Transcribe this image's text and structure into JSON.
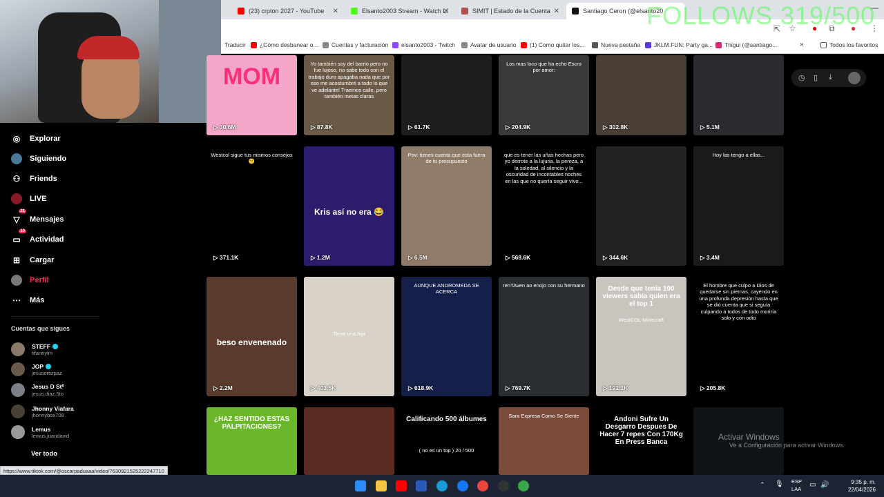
{
  "browser": {
    "tabs": [
      {
        "title": "(23) crpton 2027 - YouTube",
        "color": "#ff0000"
      },
      {
        "title": "Elsanto2003 Stream - Watch Li",
        "color": "#53fc18"
      },
      {
        "title": "SIMIT | Estado de la Cuenta",
        "color": "#b05050"
      },
      {
        "title": "Santiago Ceron (@elsanto20",
        "color": "#111111"
      }
    ],
    "bookmarks": [
      {
        "label": "Traducir"
      },
      {
        "label": "¿Cómo desbanear o..."
      },
      {
        "label": "Cuentas y facturación"
      },
      {
        "label": "elsanto2003 - Twitch"
      },
      {
        "label": "Avatar de usuario"
      },
      {
        "label": "(1) Como quitar los..."
      },
      {
        "label": "Nueva pestaña"
      },
      {
        "label": "JKLM.FUN: Party ga..."
      },
      {
        "label": "Thigui (@santiago..."
      },
      {
        "label": "Todos los favoritos"
      }
    ]
  },
  "overlay": {
    "follows_goal": "FOLLOWS 319/500"
  },
  "sidebar": {
    "nav": [
      {
        "label": "Explorar",
        "icon": "compass-icon",
        "glyph": "◎"
      },
      {
        "label": "Siguiendo",
        "icon": "following-avatar-icon",
        "glyph": "●"
      },
      {
        "label": "Friends",
        "icon": "friends-icon",
        "glyph": "⚇"
      },
      {
        "label": "LIVE",
        "icon": "live-icon",
        "glyph": "◉"
      },
      {
        "label": "Mensajes",
        "icon": "messages-icon",
        "glyph": "▽",
        "badge": "21"
      },
      {
        "label": "Actividad",
        "icon": "activity-icon",
        "glyph": "▭",
        "badge": "10"
      },
      {
        "label": "Cargar",
        "icon": "upload-icon",
        "glyph": "⊞"
      },
      {
        "label": "Perfil",
        "icon": "profile-avatar-icon",
        "glyph": "●",
        "active": true
      },
      {
        "label": "Más",
        "icon": "more-icon",
        "glyph": "⋯"
      }
    ],
    "following_header": "Cuentas que sigues",
    "following": [
      {
        "name": "STEFF",
        "handle": "tifannylm",
        "verified": true
      },
      {
        "name": "JOP",
        "handle": "jesusortizpaz",
        "verified": true
      },
      {
        "name": "Jesus D St⁰",
        "handle": "jesus.diaz.5to",
        "verified": false
      },
      {
        "name": "Jhonny Viafara",
        "handle": "jhonnybox708",
        "verified": false
      },
      {
        "name": "Lemus",
        "handle": "lemus.juandavid",
        "verified": false
      }
    ],
    "see_all": "Ver todo"
  },
  "grid": {
    "videos": [
      {
        "views": "30.6M",
        "bg": "#f4a6c8",
        "big": "MOM",
        "big_color": "#ff2d7a"
      },
      {
        "views": "87.8K",
        "bg": "#6b5a48",
        "text": "Yo también soy del barrio pero no fue lujoso, no sabe todo con el trabajo duro apagaba nada que por eso me acostumbré a todo lo que ve adelante! Traemos calle, pero también metas claras"
      },
      {
        "views": "61.7K",
        "bg": "#1e1e1e"
      },
      {
        "views": "204.9K",
        "bg": "#3a3a3a",
        "text": "Los mas loco que ha echo Escro por amor:"
      },
      {
        "views": "302.8K",
        "bg": "#4a3f37"
      },
      {
        "views": "5.1M",
        "bg": "#2b2b2f"
      },
      {
        "views": "371.1K",
        "bg": "#000000",
        "text": "Westcol sigue tus mismos consejos 😕"
      },
      {
        "views": "1.2M",
        "bg": "#2d1b6b",
        "big": "Kris así no era 😂"
      },
      {
        "views": "6.5M",
        "bg": "#8f7c68",
        "text": "Pov: tienes cuenta que esta fuera de tu presupuesto"
      },
      {
        "views": "568.6K",
        "bg": "#000000",
        "text": "que es tener las uñas hechas pero yo derrote a la lujuria, la pereza, a la soledad, al silencio y la oscuridad de incontables noches en las que no quería seguir vivo..."
      },
      {
        "views": "344.6K",
        "bg": "#222222"
      },
      {
        "views": "3.4M",
        "bg": "#1a1a1d",
        "text": "Hoy las tengo a ellas..."
      },
      {
        "views": "2.2M",
        "bg": "#5a3b2e",
        "big": "beso envenenado"
      },
      {
        "views": "403.5K",
        "bg": "#d8d2c8",
        "text": "Tiene una hija"
      },
      {
        "views": "618.9K",
        "bg": "#14204a",
        "text": "AUNQUE ANDROMEDA SE ACERCA"
      },
      {
        "views": "769.7K",
        "bg": "#2a2e33",
        "text": "renTAven ao enojo con su hermano"
      },
      {
        "views": "191.1K",
        "bg": "#c9c4bd",
        "big": "Desde que tenía 100 viewers sabía quien era el top 1",
        "text": "WestCOL Minecraft"
      },
      {
        "views": "205.8K",
        "bg": "#000000",
        "text": "El hombre que culpo a Dios de quedarse sin piernas, cayendo en una profunda depresión hasta que se dió cuenta que si seguía culpando a todos de todo moriría solo y con odio"
      },
      {
        "views": "",
        "bg": "#6ab82a",
        "big": "¿HAZ SENTIDO ESTAS PALPITACIONES?"
      },
      {
        "views": "",
        "bg": "#5a2b22"
      },
      {
        "views": "",
        "bg": "#000000",
        "big": "Calificando 500 álbumes",
        "text": "( no es un top )  20 / 500"
      },
      {
        "views": "",
        "bg": "#7a4a3a",
        "text": "Sara Expresa Como Se Siente"
      },
      {
        "views": "",
        "bg": "#000000",
        "big": "Andoni Sufre Un Desgarro Despues De Hacer 7 repes Con 170Kg En Press Banca"
      },
      {
        "views": "",
        "bg": "#101418"
      }
    ]
  },
  "status_url": "https://www.tiktok.com/@oscarpaduaaa/video/7630921525222247710",
  "windows": {
    "activate_title": "Activar Windows",
    "activate_sub": "Ve a Configuración para activar Windows."
  },
  "taskbar": {
    "lang1": "ESP",
    "lang2": "LAA",
    "time": "9:35 p. m.",
    "date": "22/04/2026"
  }
}
